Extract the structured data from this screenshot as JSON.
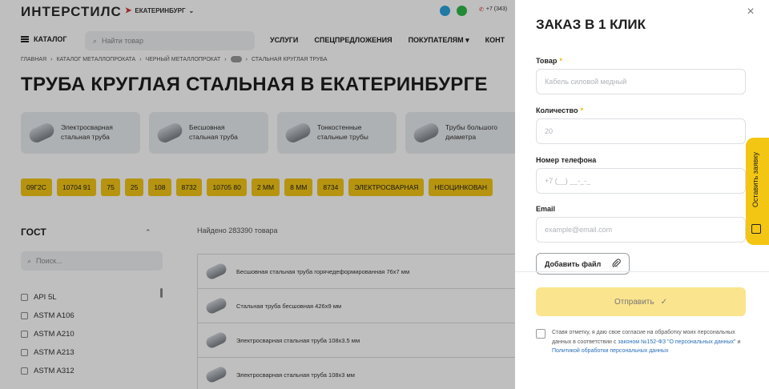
{
  "header": {
    "logo": "ИНТЕРСТИЛС",
    "city": "ЕКАТЕРИНБУРГ",
    "phone": "+7 (343)"
  },
  "nav": {
    "catalog_label": "КАТАЛОГ",
    "search_placeholder": "Найти товар",
    "links": [
      "УСЛУГИ",
      "СПЕЦПРЕДЛОЖЕНИЯ",
      "ПОКУПАТЕЛЯМ ▾",
      "КОНТ"
    ]
  },
  "breadcrumb": [
    "ГЛАВНАЯ",
    "КАТАЛОГ МЕТАЛЛОПРОКАТА",
    "ЧЕРНЫЙ МЕТАЛЛОПРОКАТ",
    "СТАЛЬНАЯ КРУГЛАЯ ТРУБА"
  ],
  "page_title": "ТРУБА КРУГЛАЯ СТАЛЬНАЯ В ЕКАТЕРИНБУРГЕ",
  "categories": [
    {
      "line1": "Электросварная",
      "line2": "стальная труба"
    },
    {
      "line1": "Бесшовная",
      "line2": "стальная труба"
    },
    {
      "line1": "Тонкостенные",
      "line2": "стальные трубы"
    },
    {
      "line1": "Трубы большого",
      "line2": "диаметра"
    }
  ],
  "tags": [
    "09Г2С",
    "10704 91",
    "75",
    "25",
    "108",
    "8732",
    "10705 80",
    "2 ММ",
    "8 ММ",
    "8734",
    "ЭЛЕКТРОСВАРНАЯ",
    "НЕОЦИНКОВАН"
  ],
  "filter": {
    "title": "ГОСТ",
    "search_placeholder": "Поиск...",
    "options": [
      "API 5L",
      "ASTM A106",
      "ASTM A210",
      "ASTM A213",
      "ASTM A312"
    ]
  },
  "results": {
    "found_text": "Найдено 283390 товара",
    "products": [
      "Бесшовная стальная труба горячедеформированная 76х7 мм",
      "Стальная труба бесшовная 426х9 мм",
      "Электросварная стальная труба 108х3.5 мм",
      "Электросварная стальная труба 108х3 мм"
    ]
  },
  "modal": {
    "title": "ЗАКАЗ В 1 КЛИК",
    "close_icon": "×",
    "fields": {
      "product": {
        "label": "Товар",
        "placeholder": "Кабель силовой медный",
        "required_mark": "*"
      },
      "quantity": {
        "label": "Количество",
        "placeholder": "20",
        "required_mark": "*"
      },
      "phone": {
        "label": "Номер телефона",
        "placeholder": "+7 (__) __-_-_"
      },
      "email": {
        "label": "Email",
        "placeholder": "example@email.com"
      }
    },
    "file_button": "Добавить файл",
    "submit_label": "Отправить",
    "consent": {
      "text_before": "Ставя отметку, я даю свое согласие на обработку моих персональных данных в соответствии с ",
      "link1": "законом №152-ФЗ \"О персональных данных\"",
      "text_mid": " и ",
      "link2": "Политикой обработки персональных данных"
    }
  },
  "side_tab": {
    "label": "Оставить заявку"
  },
  "colors": {
    "accent_yellow": "#f3c614",
    "submit_disabled": "#fbe48e",
    "link_blue": "#2a6fb8"
  }
}
